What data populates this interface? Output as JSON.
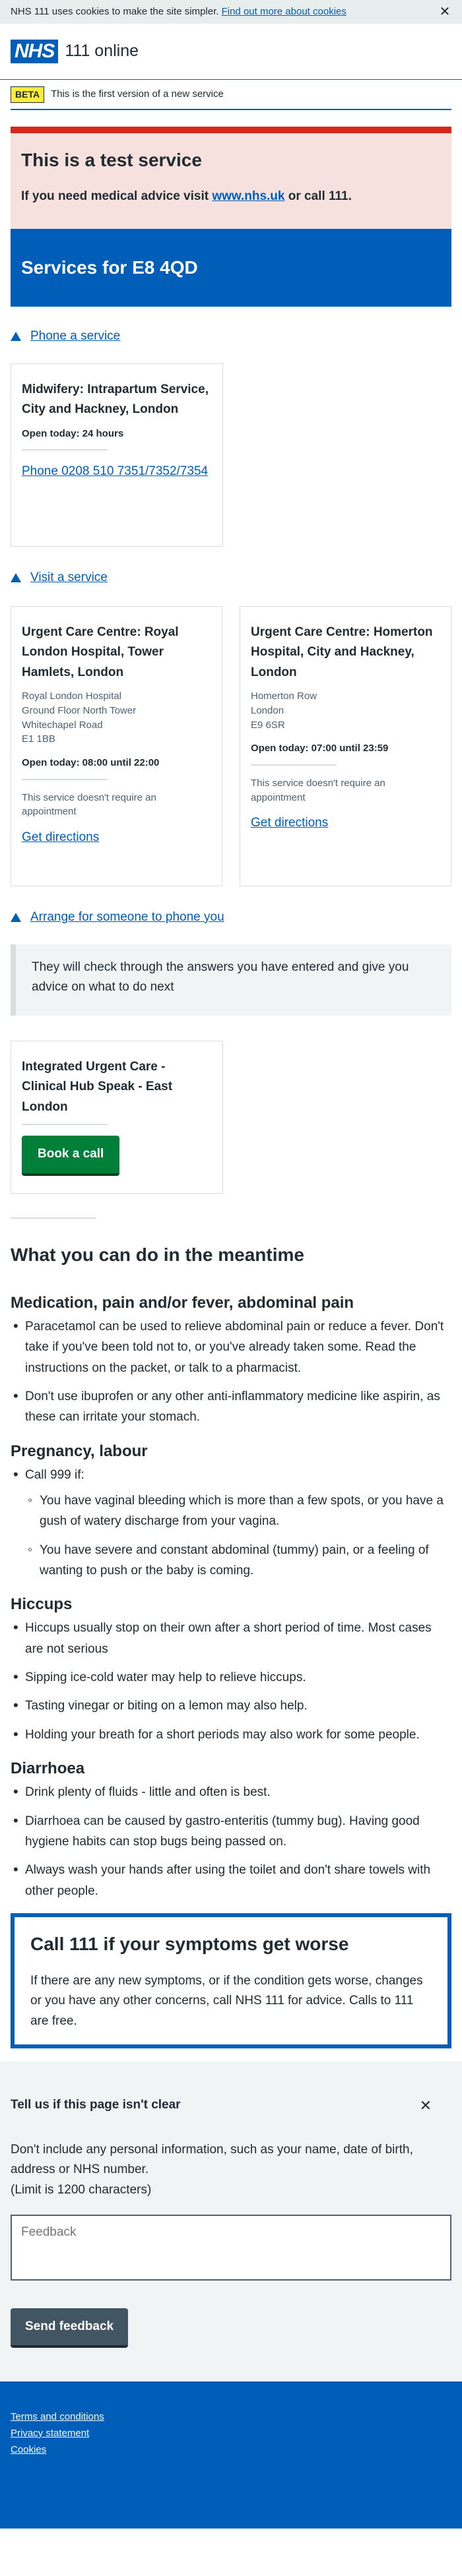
{
  "cookie": {
    "message": "NHS 111 uses cookies to make the site simpler.",
    "link": "Find out more about cookies",
    "close_icon": "close-icon"
  },
  "header": {
    "logo": "NHS",
    "service": "111 online"
  },
  "beta": {
    "tag": "BETA",
    "text": "This is the first version of a new service"
  },
  "test_service": {
    "title": "This is a test service",
    "text_before": "If you need medical advice visit ",
    "link": "www.nhs.uk",
    "text_after": " or call 111."
  },
  "banner": {
    "title": "Services for E8 4QD"
  },
  "phone_section": {
    "link": "Phone a service",
    "card": {
      "name": "Midwifery: Intrapartum Service, City and Hackney, London",
      "open": "Open today: 24 hours",
      "phone": "Phone 0208 510 7351/7352/7354"
    }
  },
  "visit_section": {
    "link": "Visit a service",
    "cards": [
      {
        "name": "Urgent Care Centre: Royal London Hospital, Tower Hamlets, London",
        "address": [
          "Royal London Hospital",
          "Ground Floor North Tower",
          "Whitechapel Road",
          "E1 1BB"
        ],
        "open": "Open today: 08:00 until 22:00",
        "note": "This service doesn't require an appointment",
        "directions": "Get directions"
      },
      {
        "name": "Urgent Care Centre: Homerton Hospital, City and Hackney, London",
        "address": [
          "Homerton Row",
          "London",
          "E9 6SR"
        ],
        "open": "Open today: 07:00 until 23:59",
        "note": "This service doesn't require an appointment",
        "directions": "Get directions"
      }
    ]
  },
  "callback_section": {
    "link": "Arrange for someone to phone you",
    "info": "They will check through the answers you have entered and give you advice on what to do next",
    "card": {
      "name": "Integrated Urgent Care - Clinical Hub Speak - East London",
      "button": "Book a call"
    }
  },
  "meantime": {
    "title": "What you can do in the meantime",
    "sections": [
      {
        "heading": "Medication, pain and/or fever, abdominal pain",
        "items": [
          "Paracetamol can be used to relieve abdominal pain or reduce a fever. Don't take if you've been told not to, or you've already taken some. Read the instructions on the packet, or talk to a pharmacist.",
          "Don't use ibuprofen or any other anti-inflammatory medicine like aspirin, as these can irritate your stomach."
        ]
      },
      {
        "heading": "Pregnancy, labour",
        "items": [
          "Call 999 if:"
        ],
        "subitems": [
          "You have vaginal bleeding which is more than a few spots, or you have a gush of watery discharge from your vagina.",
          "You have severe and constant abdominal (tummy) pain, or a feeling of wanting to push or the baby is coming."
        ]
      },
      {
        "heading": "Hiccups",
        "items": [
          "Hiccups usually stop on their own after a short period of time. Most cases are not serious",
          "Sipping ice-cold water may help to relieve hiccups.",
          "Tasting vinegar or biting on a lemon may also help.",
          "Holding your breath for a short periods may also work for some people."
        ]
      },
      {
        "heading": "Diarrhoea",
        "items": [
          "Drink plenty of fluids - little and often is best.",
          "Diarrhoea can be caused by gastro-enteritis (tummy bug). Having good hygiene habits can stop bugs being passed on.",
          "Always wash your hands after using the toilet and don't share towels with other people."
        ]
      }
    ]
  },
  "care_card": {
    "title": "Call 111 if your symptoms get worse",
    "text": "If there are any new symptoms, or if the condition gets worse, changes or you have any other concerns, call NHS 111 for advice. Calls to 111 are free."
  },
  "feedback": {
    "title": "Tell us if this page isn't clear",
    "close_icon": "close-icon",
    "text": "Don't include any personal information, such as your name, date of birth, address or NHS number.",
    "limit": "(Limit is 1200 characters)",
    "placeholder": "Feedback",
    "button": "Send feedback"
  },
  "footer": {
    "links": [
      "Terms and conditions",
      "Privacy statement",
      "Cookies"
    ]
  },
  "colors": {
    "nhs_blue": "#005eb8",
    "green": "#007f3b",
    "warning_red": "#d5281b",
    "beta_yellow": "#ffeb3b"
  }
}
